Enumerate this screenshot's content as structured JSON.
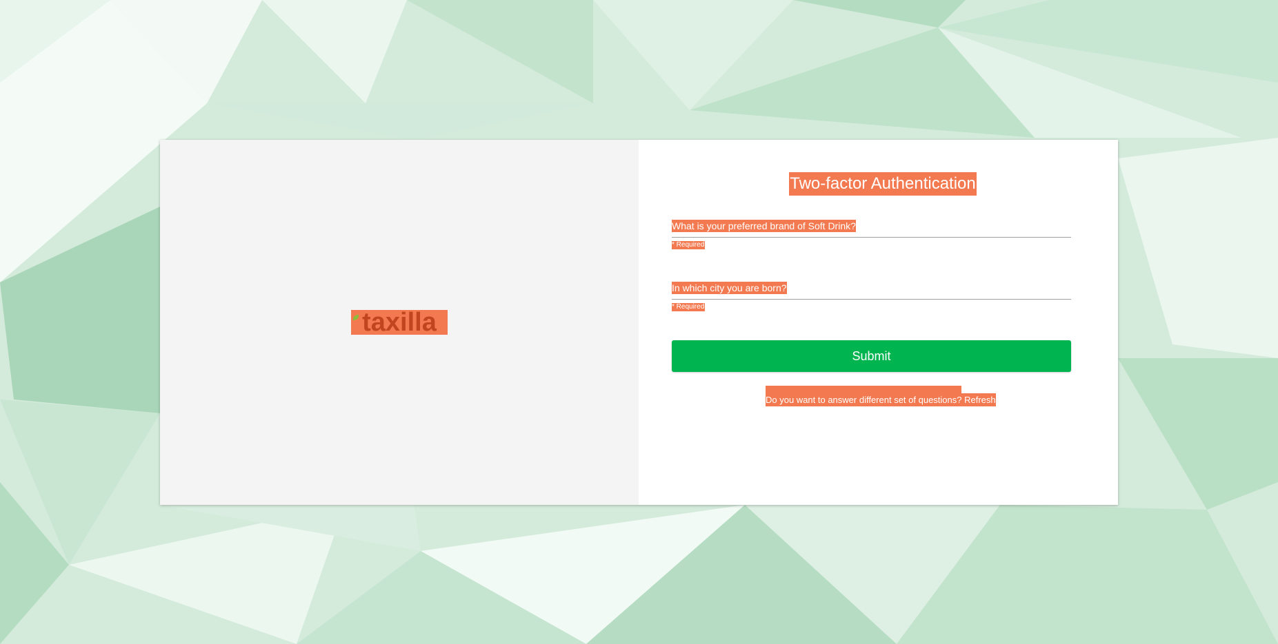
{
  "logo": {
    "text": "taxilla"
  },
  "auth": {
    "title": "Two-factor Authentication",
    "questions": [
      {
        "label": "What is your preferred brand of Soft Drink?",
        "value": "",
        "required_text": "* Required"
      },
      {
        "label": "In which city you are born?",
        "value": "",
        "required_text": "* Required"
      }
    ],
    "submit_label": "Submit",
    "refresh_prompt": "Do you want to answer different set of questions? ",
    "refresh_link": "Refresh"
  },
  "colors": {
    "accent": "#f37a50",
    "submit": "#00b450",
    "left_panel": "#f4f4f4",
    "background": "#cfe8d8"
  }
}
